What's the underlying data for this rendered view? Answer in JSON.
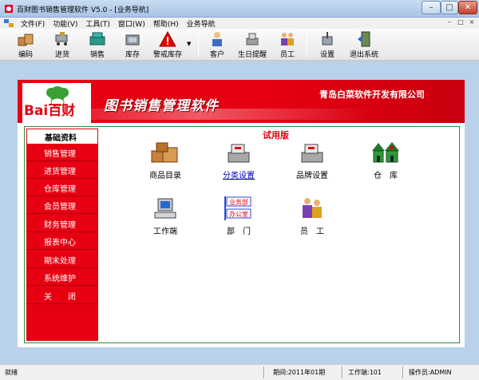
{
  "window": {
    "title": "百财图书销售管理软件 V5.0 - [业务导航]",
    "controls": {
      "minimize": "–",
      "maximize": "□",
      "close": "✕"
    }
  },
  "menu": {
    "items": [
      "文件(F)",
      "功能(V)",
      "工具(T)",
      "窗口(W)",
      "帮助(H)",
      "业务导航"
    ],
    "right_controls": [
      "–",
      "□",
      "×"
    ]
  },
  "toolbar": {
    "buttons": [
      {
        "label": "编码",
        "icon": "coding-boxes-icon"
      },
      {
        "label": "进货",
        "icon": "purchase-cart-icon"
      },
      {
        "label": "销售",
        "icon": "sales-cash-icon"
      },
      {
        "label": "库存",
        "icon": "inventory-icon"
      },
      {
        "label": "警戒库存",
        "icon": "warning-icon"
      },
      {
        "label": "客户",
        "icon": "customer-icon"
      },
      {
        "label": "生日提醒",
        "icon": "birthday-icon"
      },
      {
        "label": "员工",
        "icon": "staff-icon"
      },
      {
        "label": "设置",
        "icon": "settings-icon"
      },
      {
        "label": "退出系统",
        "icon": "exit-icon"
      }
    ]
  },
  "banner": {
    "logo": "Bai百财",
    "app_name": "图书销售管理软件",
    "company": "青岛白菜软件开发有限公司"
  },
  "nav": {
    "items": [
      "基础资料",
      "销售管理",
      "进货管理",
      "仓库管理",
      "会员管理",
      "财务管理",
      "报表中心",
      "期末处理",
      "系统维护",
      "关　　闭"
    ],
    "active_index": 0
  },
  "trial_label": "试用版",
  "grid": {
    "items": [
      {
        "label": "商品目录",
        "icon": "goods-catalog-icon"
      },
      {
        "label": "分类设置",
        "icon": "category-settings-icon"
      },
      {
        "label": "品牌设置",
        "icon": "brand-settings-icon"
      },
      {
        "label": "仓　库",
        "icon": "warehouse-icon"
      },
      {
        "label": "工作端",
        "icon": "workstation-icon"
      },
      {
        "label": "部　门",
        "icon": "department-icon"
      },
      {
        "label": "员　工",
        "icon": "employee-icon"
      }
    ],
    "department_icon_text": [
      "业务部",
      "办公室"
    ]
  },
  "status": {
    "state": "就绪",
    "period": "期间:2011年01期",
    "workstation": "工作端:101",
    "operator": "操作员:ADMIN"
  },
  "colors": {
    "brand_red": "#e60012",
    "nav_border_green": "#2f8a3a",
    "window_frame": "#b9d1ea"
  }
}
